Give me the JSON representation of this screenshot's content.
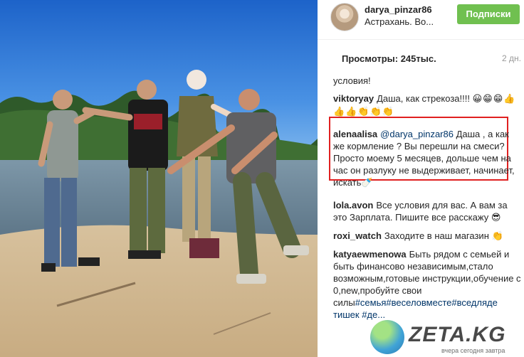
{
  "post": {
    "username": "darya_pinzar86",
    "location": "Астрахань. Во...",
    "follow_label": "Подписки",
    "views": "Просмотры: 245тыс.",
    "age": "2 дн."
  },
  "comments": [
    {
      "user": "",
      "text": "условия!",
      "emoji": ""
    },
    {
      "user": "viktoryay",
      "text": "Даша, как стрекоза!!!! ",
      "emoji": "😀😁😁👍👍👍👏👏👏"
    },
    {
      "user": "alenaalisa",
      "mention": "@darya_pinzar86",
      "text": " Даша , а как же кормление ? Вы перешли на смеси? Просто моему 5 месяцев, дольше чем на час он разлуку не выдерживает, начинает, искать",
      "emoji": "🍼"
    },
    {
      "user": "lola.avon",
      "text": "Все условия для вас. А вам за это Зарплата. Пишите все расскажу ",
      "emoji": "😎"
    },
    {
      "user": "roxi_watch",
      "text": "Заходите в наш магазин ",
      "emoji": "👏"
    },
    {
      "user": "katyaewmenowa",
      "text": "Быть рядом с семьей и быть финансово независимым,стало возможным,готовые инструкции,обучение с 0,new,пробуйте свои силы",
      "tags": [
        "#семья",
        "#веселовместе",
        "#вседляде",
        "тишек",
        "#де..."
      ]
    }
  ],
  "watermark": {
    "text": "ZETA.KG",
    "tagline": "вчера сегодня завтра"
  },
  "colors": {
    "follow": "#70c050",
    "highlight": "#e02020",
    "link": "#003569"
  }
}
